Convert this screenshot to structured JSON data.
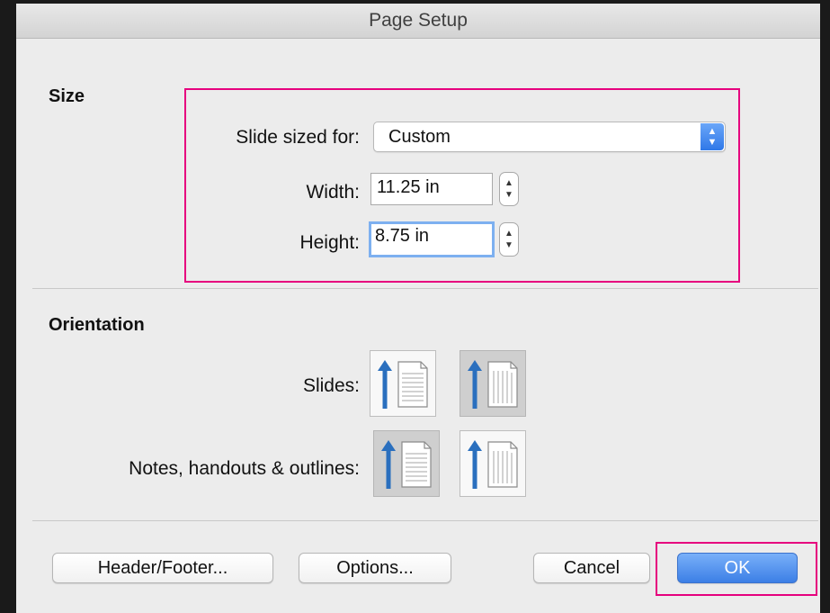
{
  "window": {
    "title": "Page Setup"
  },
  "size": {
    "heading": "Size",
    "slide_sized_for": {
      "label": "Slide sized for:",
      "value": "Custom"
    },
    "width": {
      "label": "Width:",
      "value": "11.25 in"
    },
    "height": {
      "label": "Height:",
      "value": "8.75 in"
    }
  },
  "orientation": {
    "heading": "Orientation",
    "slides": {
      "label": "Slides:",
      "selected": "landscape"
    },
    "notes": {
      "label": "Notes, handouts & outlines:",
      "selected": "portrait"
    }
  },
  "buttons": {
    "header_footer": "Header/Footer...",
    "options": "Options...",
    "cancel": "Cancel",
    "ok": "OK"
  },
  "colors": {
    "highlight": "#e6007e",
    "accent_blue": "#3c7fe6",
    "arrow_blue": "#2a6fbe"
  }
}
